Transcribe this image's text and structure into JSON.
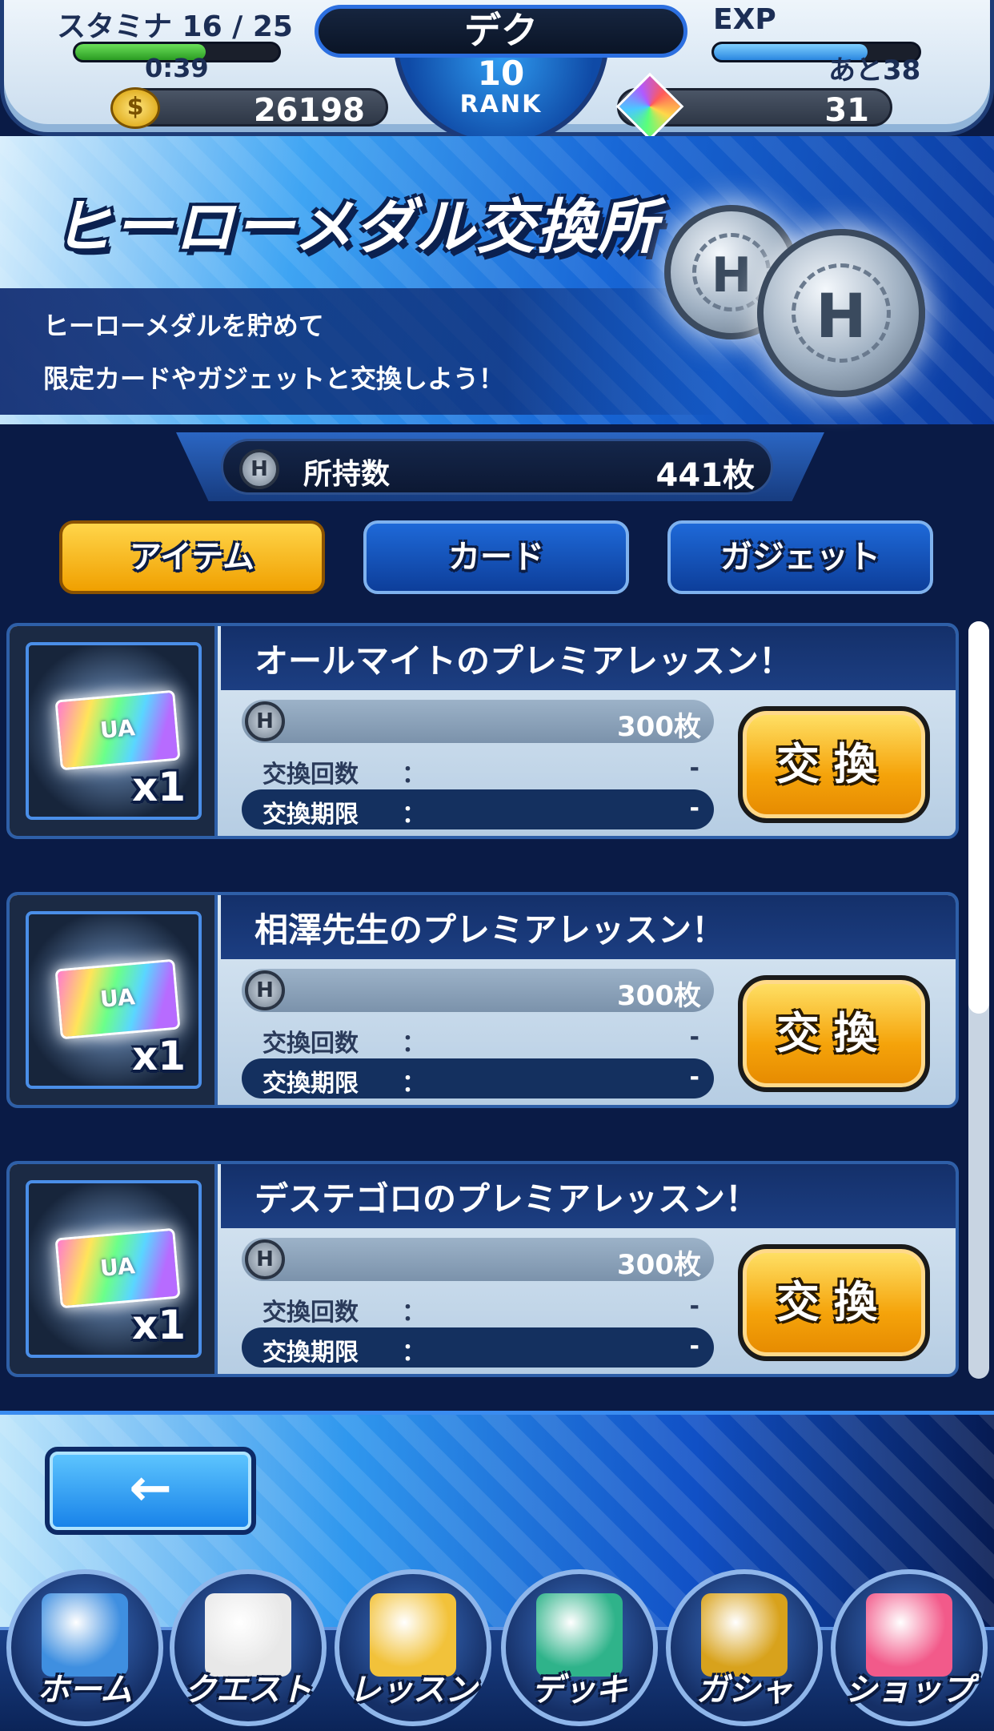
{
  "header": {
    "stamina_label": "スタミナ 16 / 25",
    "stamina_fill_fraction": 0.64,
    "stamina_timer": "0:39",
    "player_name": "デク",
    "rank_number": "10",
    "rank_label": "RANK",
    "exp_label": "EXP",
    "exp_fill_fraction": 0.75,
    "exp_remaining": "あと38",
    "coins": "26198",
    "gems": "31",
    "coin_icon": "gold-coin-icon",
    "gem_icon": "rainbow-gem-icon"
  },
  "banner": {
    "title": "ヒーローメダル交換所",
    "line1": "ヒーローメダルを貯めて",
    "line2": "限定カードやガジェットと交換しよう！",
    "medal_letter": "H"
  },
  "medal_holding": {
    "icon_letter": "H",
    "label": "所持数",
    "count": "441枚"
  },
  "tabs": [
    {
      "label": "アイテム",
      "active": true
    },
    {
      "label": "カード",
      "active": false
    },
    {
      "label": "ガジェット",
      "active": false
    }
  ],
  "items": [
    {
      "title": "オールマイトのプレミアレッスン！",
      "icon_letter": "H",
      "price": "300枚",
      "count_label": "交換回数",
      "count_colon": "：",
      "count_value": "-",
      "limit_label": "交換期限",
      "limit_colon": "：",
      "limit_value": "-",
      "quantity": "x1",
      "ticket_mark": "UA",
      "button_label": "交換"
    },
    {
      "title": "相澤先生のプレミアレッスン！",
      "icon_letter": "H",
      "price": "300枚",
      "count_label": "交換回数",
      "count_colon": "：",
      "count_value": "-",
      "limit_label": "交換期限",
      "limit_colon": "：",
      "limit_value": "-",
      "quantity": "x1",
      "ticket_mark": "UA",
      "button_label": "交換"
    },
    {
      "title": "デステゴロのプレミアレッスン！",
      "icon_letter": "H",
      "price": "300枚",
      "count_label": "交換回数",
      "count_colon": "：",
      "count_value": "-",
      "limit_label": "交換期限",
      "limit_colon": "：",
      "limit_value": "-",
      "quantity": "x1",
      "ticket_mark": "UA",
      "button_label": "交換"
    }
  ],
  "back_button": {
    "glyph": "←"
  },
  "nav": [
    {
      "label": "ホーム",
      "icon": "home-buildings-icon",
      "color": "#3f8fe0"
    },
    {
      "label": "クエスト",
      "icon": "quest-fist-icon",
      "color": "#e8e8e8"
    },
    {
      "label": "レッスン",
      "icon": "lesson-clipboard-icon",
      "color": "#f2c23a"
    },
    {
      "label": "デッキ",
      "icon": "deck-cards-icon",
      "color": "#2fb38a"
    },
    {
      "label": "ガシャ",
      "icon": "gacha-briefcase-icon",
      "color": "#d8a21c"
    },
    {
      "label": "ショップ",
      "icon": "shop-gem-icon",
      "color": "#f25a8a"
    }
  ],
  "colors": {
    "accent_blue": "#1766d6",
    "tab_active": "#f0a000",
    "stamina_bar": "#3fbf3a",
    "exp_bar": "#3aa0f0"
  }
}
